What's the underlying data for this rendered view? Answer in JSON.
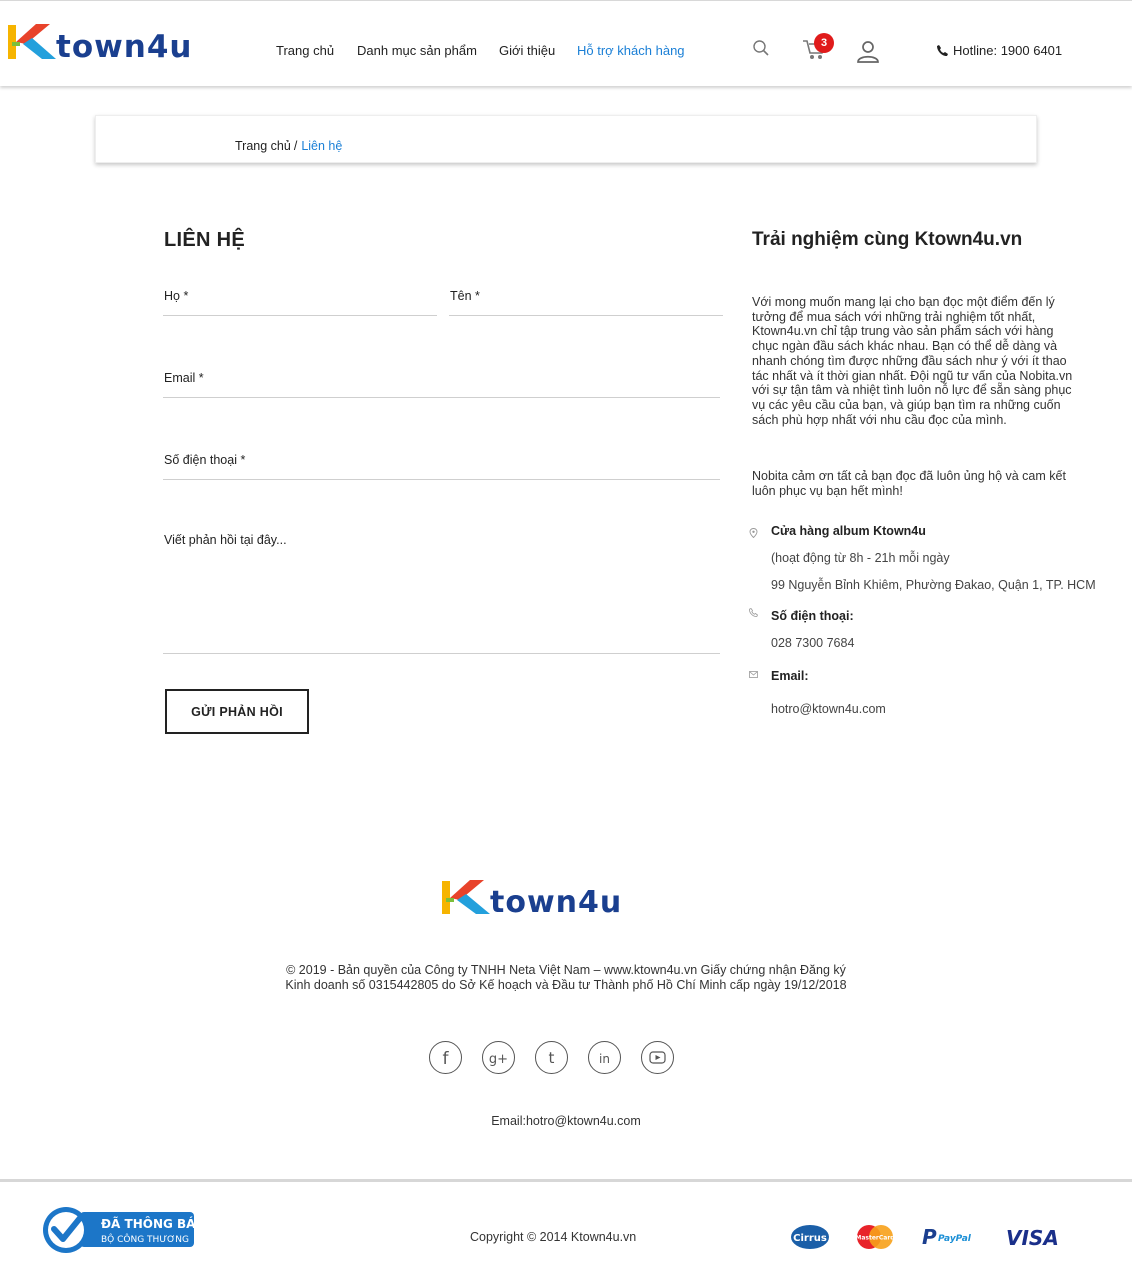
{
  "brand": {
    "logo_text": "Ktown4u",
    "logo_accent": "#e8432b",
    "logo_main": "#1a3f8f"
  },
  "header": {
    "nav": [
      "Trang chủ",
      "Danh mục sản phẩm",
      "Giới thiệu",
      "Hỗ trợ khách hàng"
    ],
    "active_nav": "Hỗ trợ khách hàng",
    "cart_count": "3",
    "hotline": "Hotline: 1900 6401",
    "icons": [
      "search-icon",
      "cart-icon",
      "user-icon",
      "phone-icon"
    ]
  },
  "breadcrumb": {
    "home": "Trang chủ",
    "separator": "/",
    "current": "Liên hệ"
  },
  "form": {
    "title": "LIÊN HỆ",
    "last_name_label": "Họ *",
    "first_name_label": "Tên *",
    "email_label": "Email *",
    "phone_label": "Số điện thoại *",
    "message_placeholder": "Viết phản hồi tại đây...",
    "submit_label": "GỬI PHẢN HỒI"
  },
  "info": {
    "title": "Trải nghiệm cùng Ktown4u.vn",
    "paragraph1": "Với mong muốn mang lại cho bạn đọc một điểm đến lý tưởng để mua sách với những trải nghiệm tốt nhất, Ktown4u.vn chỉ tập trung vào sản phẩm sách với hàng chục ngàn đầu sách khác nhau. Bạn có thể dễ dàng và nhanh chóng tìm được những đầu sách như ý với ít thao tác nhất và ít thời gian nhất. Đội ngũ tư vấn của Nobita.vn với sự tận tâm và nhiệt tình luôn nỗ lực để sẵn sàng phục vụ các yêu cầu của bạn, và giúp bạn tìm ra những cuốn sách phù hợp nhất với nhu cầu đọc của mình.",
    "paragraph2": "Nobita cảm ơn tất cả bạn đọc đã luôn ủng hộ và cam kết luôn phục vụ bạn hết mình!",
    "store_label": "Cửa hàng album Ktown4u",
    "store_hours": "(hoạt động từ 8h - 21h mỗi ngày",
    "store_address": "99 Nguyễn Bỉnh Khiêm, Phường Đakao, Quận 1, TP. HCM",
    "phone_label": "Số điện thoại:",
    "phone": "028 7300 7684",
    "email_label": "Email:",
    "email": "hotro@ktown4u.com"
  },
  "footer": {
    "copyright_notice": "© 2019 - Bản quyền của Công ty TNHH Neta Việt Nam – www.ktown4u.vn Giấy chứng nhận Đăng ký Kinh doanh số 0315442805 do Sở Kế hoạch và Đầu tư Thành phố Hồ Chí Minh cấp ngày 19/12/2018",
    "social": [
      "facebook-icon",
      "google-plus-icon",
      "tumblr-icon",
      "linkedin-icon",
      "youtube-icon"
    ],
    "email": "Email:hotro@ktown4u.com",
    "bottom_copyright": "Copyright © 2014 Ktown4u.vn",
    "cert_title": "ĐÃ THÔNG BÁO",
    "cert_sub": "BỘ CÔNG THƯƠNG",
    "payments": [
      "Cirrus",
      "MasterCard",
      "PayPal",
      "VISA"
    ]
  }
}
